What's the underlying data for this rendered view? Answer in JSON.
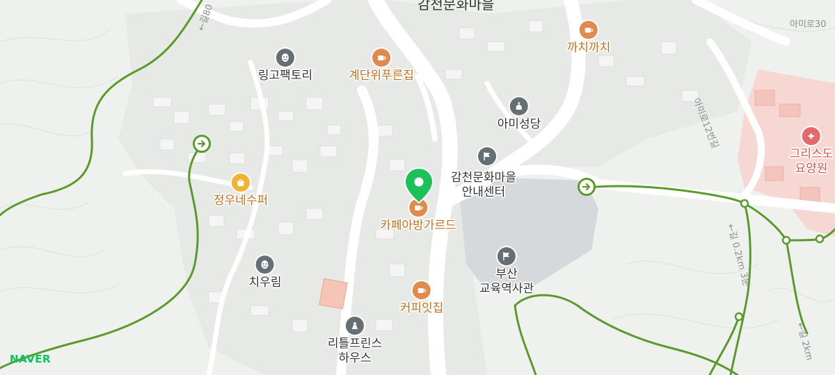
{
  "map": {
    "brand": "NAVER",
    "top_label": "감천문화마을",
    "street_labels": {
      "amiro30": "아미로30",
      "amiro12": "아미로12번길",
      "gil_left": "←길80",
      "trail_a": "←길 0.2km 3분",
      "trail_b": "←길 2km"
    },
    "selected_place": "카페아방가르드",
    "pois": {
      "ringo": "링고팩토리",
      "stairs": "계단위푸른집",
      "kkachi": "까치까치",
      "ami_church": "아미성당",
      "info_line1": "감천문화마을",
      "info_line2": "안내센터",
      "hospital_line1": "그리스도",
      "hospital_line2": "요양원",
      "jungwoo": "정우네수퍼",
      "chiwoo": "치우림",
      "busan_line1": "부산",
      "busan_line2": "교육역사관",
      "coffee": "커피잇집",
      "little_line1": "리틀프린스",
      "little_line2": "하우스"
    },
    "icons": {
      "theater": "theater-icon",
      "cafe": "coffee-cup-icon",
      "church": "church-icon",
      "flag": "flag-icon",
      "hospital": "hospital-icon",
      "store": "store-icon",
      "sculpture": "sculpture-icon",
      "gate": "entrance-arrow-icon",
      "location_pin": "location-pin-icon"
    },
    "colors": {
      "pin_green": "#1ec05a",
      "trail_green": "#5a9a2a",
      "cafe_orange": "#e08a4e",
      "hospital_red": "#e36a6a"
    }
  }
}
